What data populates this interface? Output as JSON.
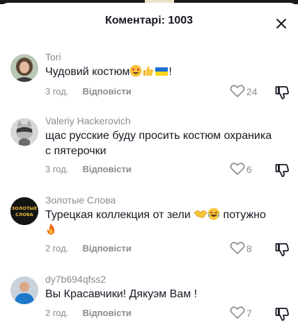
{
  "header": {
    "title": "Коментарі: 1003"
  },
  "comments": [
    {
      "author": "Tori",
      "text_main": "Чудовий костюм",
      "text_end": "!",
      "time": "3 год.",
      "reply": "Відповісти",
      "likes": "24"
    },
    {
      "author": "Valeriy Hackerovich",
      "text": "щас русские буду просить костюм охраника с пятерочки",
      "time": "3 год.",
      "reply": "Відповісти",
      "likes": "6"
    },
    {
      "author": "Золотые Слова",
      "avatar_text": "ЗОЛОТЫЕ СЛОВА",
      "text_a": "Турецкая коллекция от зели",
      "text_b": "потужно",
      "time": "2 год.",
      "reply": "Відповісти",
      "likes": "8"
    },
    {
      "author": "dy7b694qfss2",
      "text": "Вы Красавчики! Дякуэм Вам !",
      "time": "2 год.",
      "reply": "Відповісти",
      "likes": "7"
    }
  ],
  "colors": {
    "muted": "#8a8b91",
    "text": "#161823",
    "background": "#ffffff"
  },
  "icons": [
    "close-icon",
    "heart-icon",
    "dislike-icon",
    "star-eyes-emoji",
    "thumbs-up-emoji",
    "ukraine-flag-emoji",
    "handshake-emoji",
    "laughing-emoji",
    "fire-emoji"
  ]
}
